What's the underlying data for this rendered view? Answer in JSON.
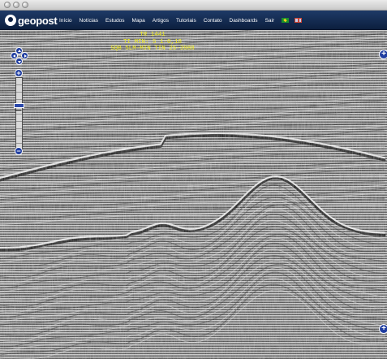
{
  "window": {
    "controls": [
      "close-button",
      "minimize-button",
      "zoom-button"
    ]
  },
  "header": {
    "logo_text": "geopost",
    "menu": [
      {
        "label": "Início"
      },
      {
        "label": "Notícias"
      },
      {
        "label": "Estudos"
      },
      {
        "label": "Mapa"
      },
      {
        "label": "Artigos"
      },
      {
        "label": "Tutoriais"
      },
      {
        "label": "Contato"
      },
      {
        "label": "Dashboards"
      },
      {
        "label": "Sair"
      }
    ],
    "language_flags": [
      {
        "icon": "brazil-flag-icon"
      },
      {
        "icon": "uk-flag-icon"
      }
    ]
  },
  "viewer": {
    "overlay_lines": [
      "TR 1441",
      "TI MIN: 5 1-0,18",
      "SQB 5LM-MIN TIN 25-3988"
    ],
    "controls": {
      "pan_icons": [
        "pan-up-icon",
        "pan-down-icon",
        "pan-left-icon",
        "pan-right-icon"
      ],
      "zoom_in_label": "+",
      "zoom_out_label": "−",
      "zoom_mid_label": "−",
      "expand_label": "+"
    },
    "colors": {
      "control_blue": "#1f3da0",
      "overlay_yellow": "#f3ee1c",
      "nav_navy": "#0c1f3e"
    }
  }
}
